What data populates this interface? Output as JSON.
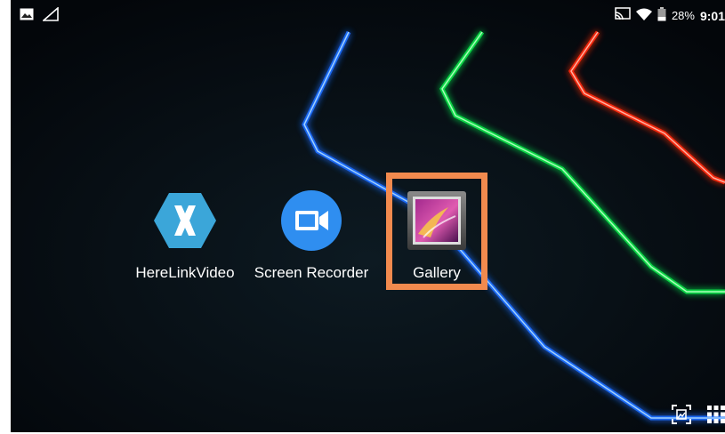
{
  "statusbar": {
    "left_icons": [
      "image-icon",
      "signal-empty-icon"
    ],
    "right_icons": [
      "cast-icon",
      "wifi-icon",
      "battery-icon"
    ],
    "battery": "28%",
    "time": "9:01"
  },
  "apps": [
    {
      "label": "HereLinkVideo",
      "icon": "xamarin-x-icon",
      "color": "#3ba6d9"
    },
    {
      "label": "Screen Recorder",
      "icon": "video-camera-icon",
      "color": "#2f8ef0"
    },
    {
      "label": "Gallery",
      "icon": "gallery-icon",
      "color": "#6b6b6b"
    }
  ],
  "highlight_color": "#f28a4e",
  "bottom_bar_icons": [
    "screenshot-icon",
    "app-drawer-grid-icon"
  ]
}
